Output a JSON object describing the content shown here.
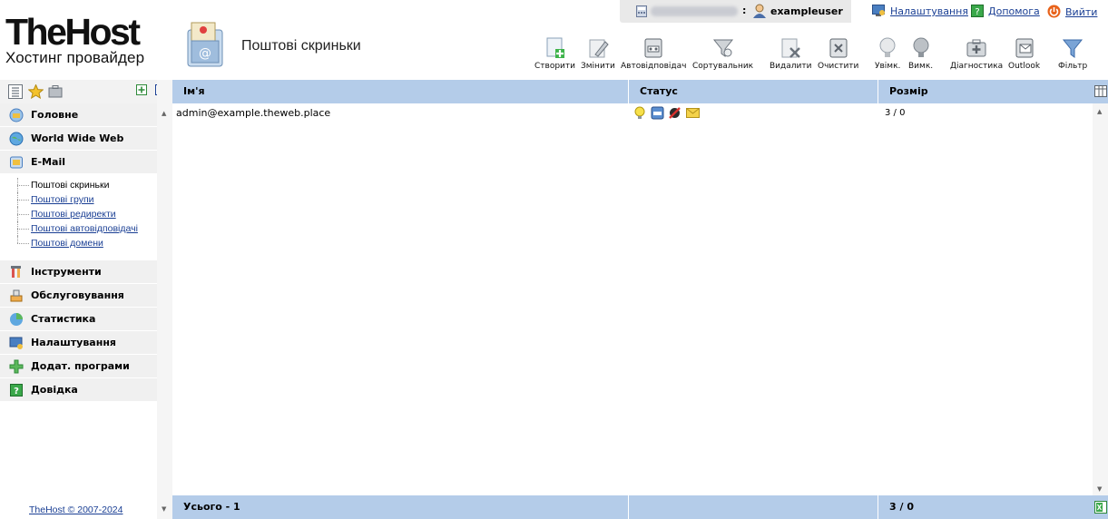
{
  "brand": {
    "title": "TheHost",
    "subtitle": "Хостинг провайдер"
  },
  "page": {
    "title": "Поштові скриньки"
  },
  "user": {
    "name": "exampleuser"
  },
  "top_links": {
    "settings": "Налаштування",
    "help": "Допомога",
    "logout": "Вийти"
  },
  "toolbar": {
    "create": "Створити",
    "edit": "Змінити",
    "autoreply": "Автовідповідач",
    "sorter": "Сортувальник",
    "delete": "Видалити",
    "clear": "Очистити",
    "enable": "Увімк.",
    "disable": "Вимк.",
    "diagnostics": "Діагностика",
    "outlook": "Outlook",
    "filter": "Фільтр"
  },
  "sidebar": {
    "sections": {
      "home": "Головне",
      "www": "World Wide Web",
      "email": "E-Mail",
      "tools": "Інструменти",
      "service": "Обслуговування",
      "stats": "Статистика",
      "settings": "Налаштування",
      "addons": "Додат. програми",
      "help": "Довідка"
    },
    "email_items": {
      "mailboxes": "Поштові скриньки",
      "groups": "Поштові групи",
      "redirects": "Поштові редиректи",
      "autoresponders": "Поштові автовідповідачі",
      "domains": "Поштові домени"
    },
    "footer": "TheHost © 2007-2024"
  },
  "table": {
    "columns": {
      "name": "Ім'я",
      "status": "Статус",
      "size": "Розмір"
    },
    "rows": [
      {
        "name": "admin@example.theweb.place",
        "size": "3 / 0"
      }
    ],
    "footer": {
      "total": "Усього - 1",
      "size": "3 / 0"
    }
  },
  "colors": {
    "header_blue": "#b4cce9",
    "link": "#1a3f94",
    "sidebar_bg": "#f0f0f0"
  }
}
